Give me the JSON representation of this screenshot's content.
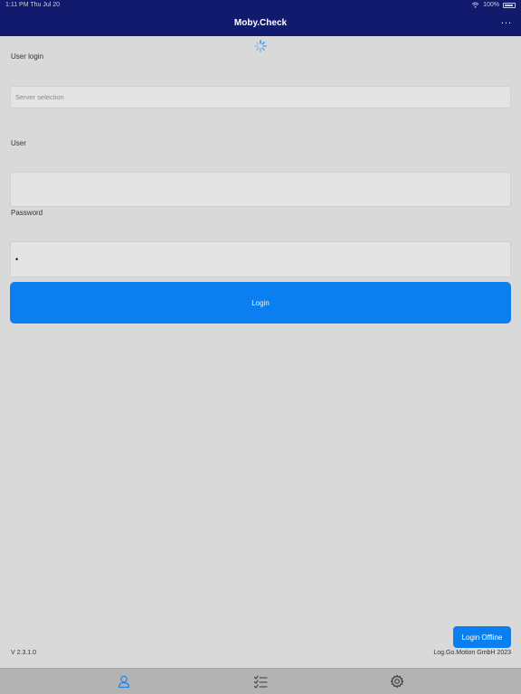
{
  "status_bar": {
    "time": "1:11 PM",
    "date": "Thu Jul 20",
    "battery": "100%",
    "wifi_icon": "wifi-icon",
    "battery_icon": "battery-icon"
  },
  "header": {
    "title": "Moby.Check",
    "more_label": "...",
    "loading_icon": "spinner-icon"
  },
  "form": {
    "section_title": "User login",
    "server_placeholder": "Server selection",
    "user_label": "User",
    "user_value": "",
    "password_label": "Password",
    "password_value": "•",
    "login_label": "Login"
  },
  "footer": {
    "offline_label": "Login Offline",
    "version": "V 2.3.1.0",
    "company": "Log.Go.Motion GmbH 2023"
  },
  "tabbar": {
    "items": [
      {
        "icon": "user-icon",
        "active": true
      },
      {
        "icon": "checklist-icon",
        "active": false
      },
      {
        "icon": "gear-icon",
        "active": false
      }
    ]
  },
  "colors": {
    "header_bg": "#121a6e",
    "accent": "#0b7ff0",
    "page_bg": "#d9d9d9",
    "tabbar_bg": "#b3b3b3"
  }
}
